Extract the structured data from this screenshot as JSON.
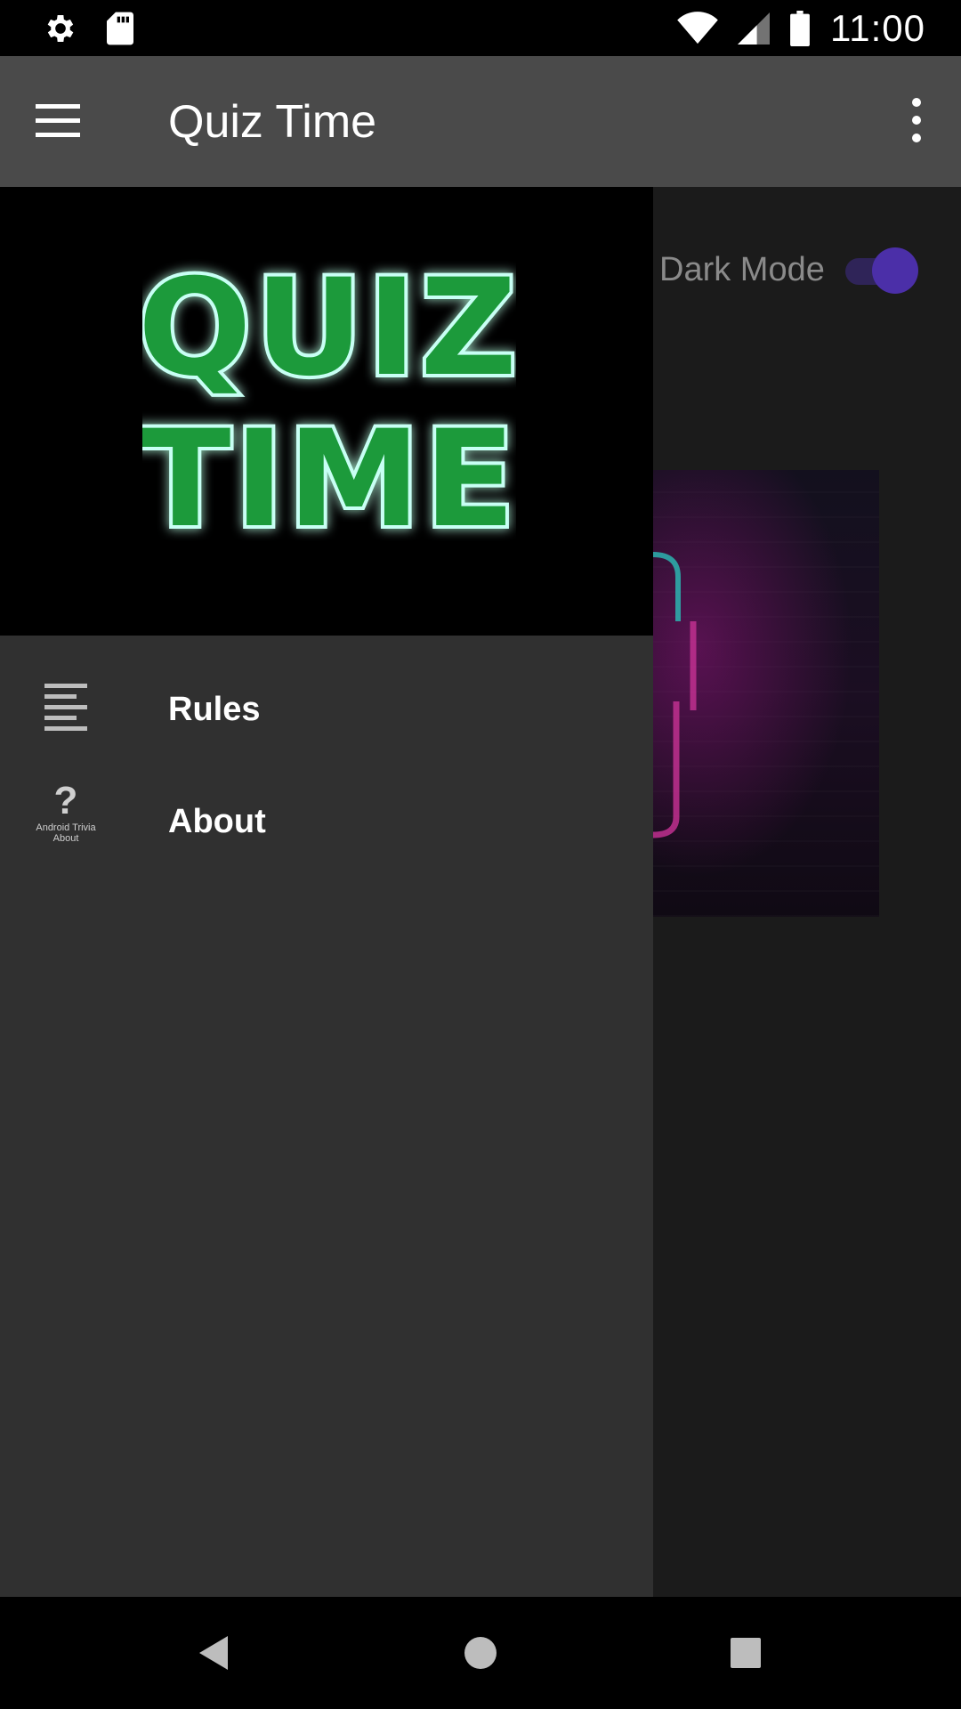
{
  "status_bar": {
    "time": "11:00",
    "left_icons": [
      "settings-icon",
      "sd-card-icon"
    ],
    "right_icons": [
      "wifi-icon",
      "cell-signal-icon",
      "battery-icon"
    ]
  },
  "app_bar": {
    "title": "Quiz Time",
    "menu_icon": "menu-icon",
    "overflow_icon": "more-vert-icon",
    "background": "#4a4a4a"
  },
  "drawer": {
    "header_logo_text": [
      "QUIZ",
      "TIME"
    ],
    "items": [
      {
        "label": "Rules",
        "icon": "rules-list-icon"
      },
      {
        "label": "About",
        "icon": "about-question-icon",
        "icon_caption_lines": [
          "Android Trivia",
          "About"
        ]
      }
    ],
    "background": "#303030"
  },
  "content": {
    "dark_mode_label": "Dark Mode",
    "dark_mode_on": true,
    "accent": "#4b2fa8"
  },
  "nav_bar": {
    "buttons": [
      "back-icon",
      "home-icon",
      "recents-icon"
    ]
  }
}
